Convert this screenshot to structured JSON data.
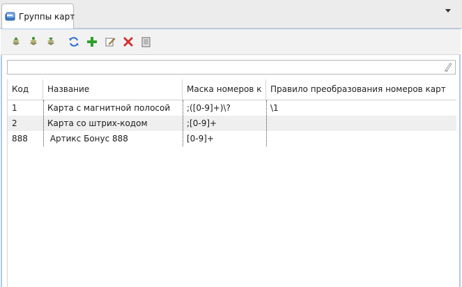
{
  "tab": {
    "title": "Группы карт",
    "icon": "card-group-icon",
    "menu_icon": "dropdown-arrow-icon"
  },
  "toolbar": {
    "buttons": [
      {
        "name": "move-up-button",
        "icon": "move-up-icon"
      },
      {
        "name": "move-first-button",
        "icon": "move-level-icon"
      },
      {
        "name": "move-down-button",
        "icon": "move-down-icon"
      },
      {
        "name": "refresh-button",
        "icon": "refresh-icon"
      },
      {
        "name": "add-button",
        "icon": "plus-icon"
      },
      {
        "name": "edit-button",
        "icon": "edit-icon"
      },
      {
        "name": "delete-button",
        "icon": "delete-icon"
      },
      {
        "name": "copy-button",
        "icon": "copy-icon"
      }
    ]
  },
  "filter": {
    "value": "",
    "placeholder": ""
  },
  "table": {
    "columns": [
      "Код",
      "Название",
      "Маска номеров к",
      "Правило преобразования номеров карт"
    ],
    "rows": [
      [
        "1",
        "Карта с магнитной полосой",
        ";([0-9]+)\\?",
        "\\1"
      ],
      [
        "2",
        "Карта со штрих-кодом",
        ";[0-9]+",
        ""
      ],
      [
        "888",
        " Артикс Бонус 888",
        "[0-9]+",
        ""
      ]
    ]
  },
  "colors": {
    "accent_border": "#a9c8ef",
    "alt_row": "#efefef",
    "header_bg": "#ececec"
  }
}
